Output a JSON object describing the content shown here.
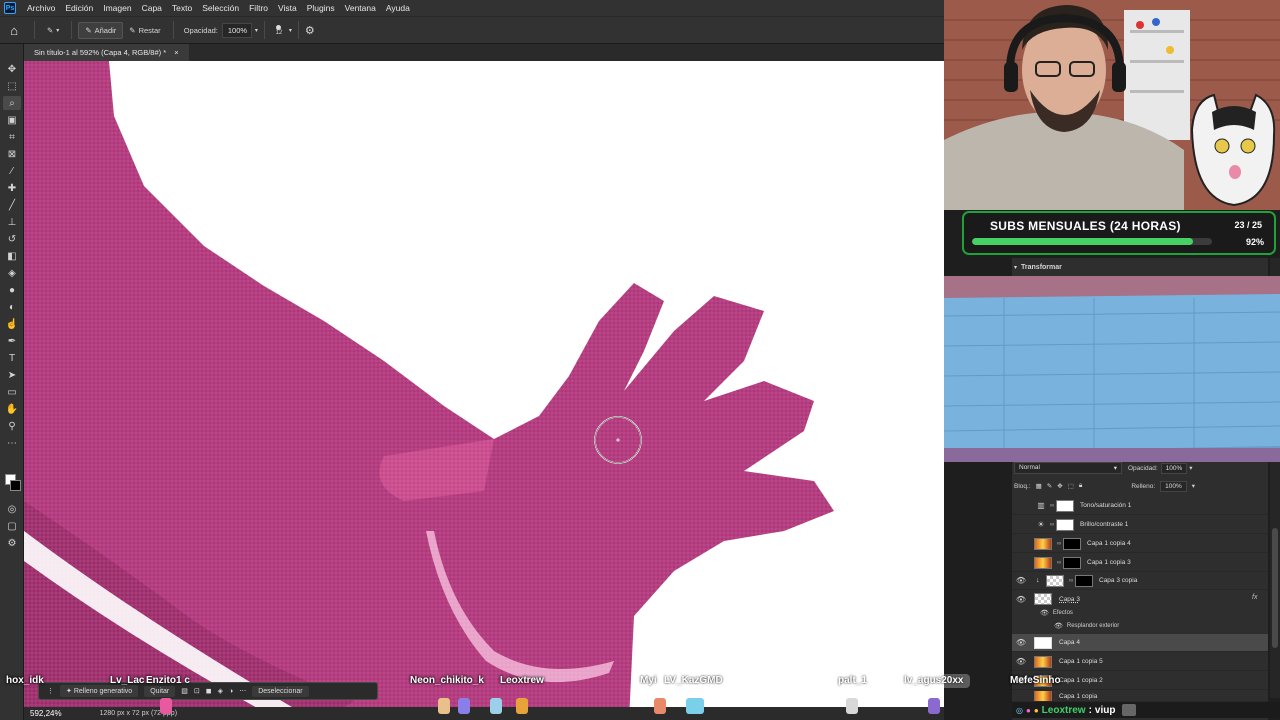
{
  "menubar": {
    "logo": "Ps",
    "items": [
      "Archivo",
      "Edición",
      "Imagen",
      "Capa",
      "Texto",
      "Selección",
      "Filtro",
      "Vista",
      "Plugins",
      "Ventana",
      "Ayuda"
    ]
  },
  "options": {
    "add_label": "Añadir",
    "subtract_label": "Restar",
    "opacity_label": "Opacidad:",
    "opacity_value": "100%",
    "brush_size": "12"
  },
  "document": {
    "tab_label": "Sin título-1 al 592% (Capa 4, RGB/8#) *"
  },
  "subs": {
    "title": "SUBS MENSUALES (24 HORAS)",
    "count": "23 / 25",
    "percent": "92%",
    "progress": 0.92
  },
  "panel": {
    "section": "Transformar",
    "blend_mode": "Normal",
    "opacity_label": "Opacidad:",
    "opacity_value": "100%",
    "lock_label": "Bloq.:",
    "fill_label": "Relleno:",
    "fill_value": "100%"
  },
  "layers": [
    {
      "name": "Tono/saturación 1"
    },
    {
      "name": "Brillo/contraste 1"
    },
    {
      "name": "Capa 1 copia 4"
    },
    {
      "name": "Capa 1 copia 3"
    },
    {
      "name": "Capa 3 copia"
    },
    {
      "name": "Capa 3"
    },
    {
      "name": "Capa 4"
    },
    {
      "name": "Capa 1 copia 5"
    },
    {
      "name": "Capa 1 copia 2"
    },
    {
      "name": "Capa 1 copia"
    }
  ],
  "effects": {
    "label": "Efectos",
    "glow": "Resplandor exterior"
  },
  "contextbar": {
    "generative_fill": "Relleno generativo",
    "subtract": "Quitar",
    "deselect": "Deseleccionar"
  },
  "status": {
    "zoom": "592,24%",
    "size": "1280 px x 72 px (72 ppp)"
  },
  "chat_overlay": {
    "names": [
      "hox_idk",
      "Lv_Lac",
      "Enzito1 c",
      "Neon_chikito_k",
      "Leoxtrew",
      "Myi",
      "LV_KazGMD",
      "palt_1",
      "lv_agus20xx",
      "MefeSinho"
    ],
    "chat_user": "Leoxtrew",
    "chat_message": "viup"
  },
  "colors": {
    "accent": "#1fa339",
    "canvas_pink": "#b0357a",
    "panel_bg": "#2e2e2e"
  }
}
